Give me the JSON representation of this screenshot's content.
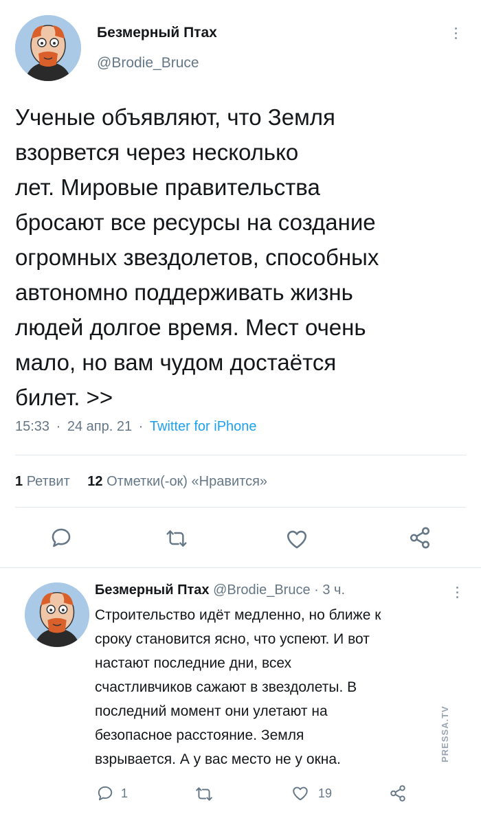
{
  "tweet": {
    "display_name": "Безмерный Птах",
    "handle": "@Brodie_Bruce",
    "text_lines": [
      "Ученые объявляют, что Земля",
      "взорвется через несколько",
      "лет. Мировые правительства",
      "бросают все ресурсы на создание",
      "огромных звездолетов, способных",
      "автономно поддерживать жизнь",
      "людей долгое время. Мест очень",
      "мало, но вам чудом достаётся",
      "билет. >>"
    ],
    "time": "15:33",
    "separator": "·",
    "date": "24 апр. 21",
    "source": "Twitter for iPhone",
    "retweet_count": "1",
    "retweet_label": "Ретвит",
    "like_count": "12",
    "like_label": "Отметки(-ок) «Нравится»"
  },
  "reply": {
    "display_name": "Безмерный Птах",
    "handle": "@Brodie_Bruce",
    "time_ago": "· 3 ч.",
    "text_lines": [
      "Строительство идёт медленно, но ближе к",
      "сроку становится ясно, что успеют. И вот",
      "настают последние дни, всех",
      "счастливчиков сажают в звездолеты. В",
      "последний момент они улетают на",
      "безопасное расстояние. Земля",
      "взрывается. А у вас место не у окна."
    ],
    "reply_count": "1",
    "like_count": "19"
  },
  "watermark": "PRESSA.TV",
  "colors": {
    "accent": "#1da1f2",
    "text": "#14171a",
    "secondary": "#657786",
    "icon": "#657786"
  },
  "icons": [
    "reply-icon",
    "retweet-icon",
    "like-icon",
    "share-icon",
    "more-icon"
  ]
}
